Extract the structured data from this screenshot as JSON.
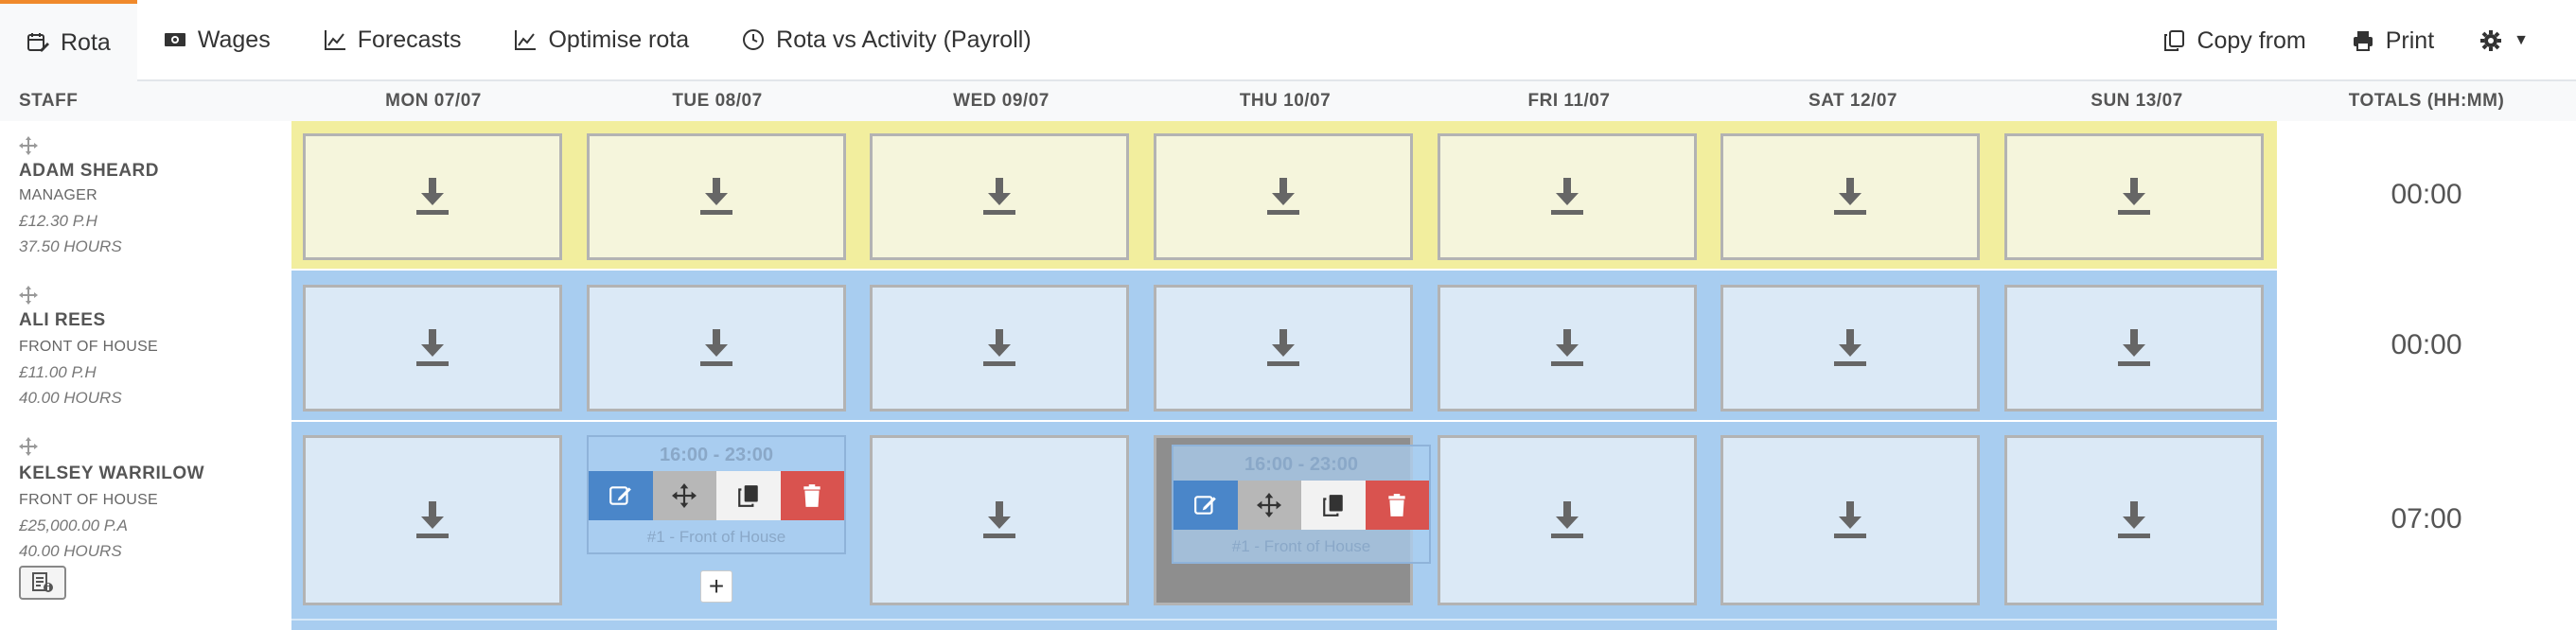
{
  "nav": {
    "tabs": [
      {
        "label": "Rota",
        "icon": "calendar-edit-icon",
        "active": true
      },
      {
        "label": "Wages",
        "icon": "money-icon",
        "active": false
      },
      {
        "label": "Forecasts",
        "icon": "line-chart-icon",
        "active": false
      },
      {
        "label": "Optimise rota",
        "icon": "line-chart-icon",
        "active": false
      },
      {
        "label": "Rota vs Activity (Payroll)",
        "icon": "clock-icon",
        "active": false
      }
    ],
    "copy_from": "Copy from",
    "print": "Print"
  },
  "grid": {
    "staff_header": "STAFF",
    "totals_header": "TOTALS (HH:MM)",
    "days": [
      "MON 07/07",
      "TUE 08/07",
      "WED 09/07",
      "THU 10/07",
      "FRI 11/07",
      "SAT 12/07",
      "SUN 13/07"
    ]
  },
  "staff": [
    {
      "name": "ADAM SHEARD",
      "role": "MANAGER",
      "rate": "£12.30 P.H",
      "hours": "37.50 HOURS",
      "total": "00:00"
    },
    {
      "name": "ALI REES",
      "role": "FRONT OF HOUSE",
      "rate": "£11.00 P.H",
      "hours": "40.00 HOURS",
      "total": "00:00"
    },
    {
      "name": "KELSEY WARRILOW",
      "role": "FRONT OF HOUSE",
      "rate": "£25,000.00 P.A",
      "hours": "40.00 HOURS",
      "total": "07:00"
    }
  ],
  "shifts": [
    {
      "time": "16:00 - 23:00",
      "label": "#1 - Front of House"
    },
    {
      "time": "16:00 - 23:00",
      "label": "#1 - Front of House"
    }
  ],
  "colors": {
    "manager_row": "#f2ee9e",
    "manager_cell": "#f5f5dc",
    "foh_row": "#a8cdf0",
    "foh_cell": "#dbe9f6",
    "accent": "#f0892b"
  },
  "add_shift": "+"
}
